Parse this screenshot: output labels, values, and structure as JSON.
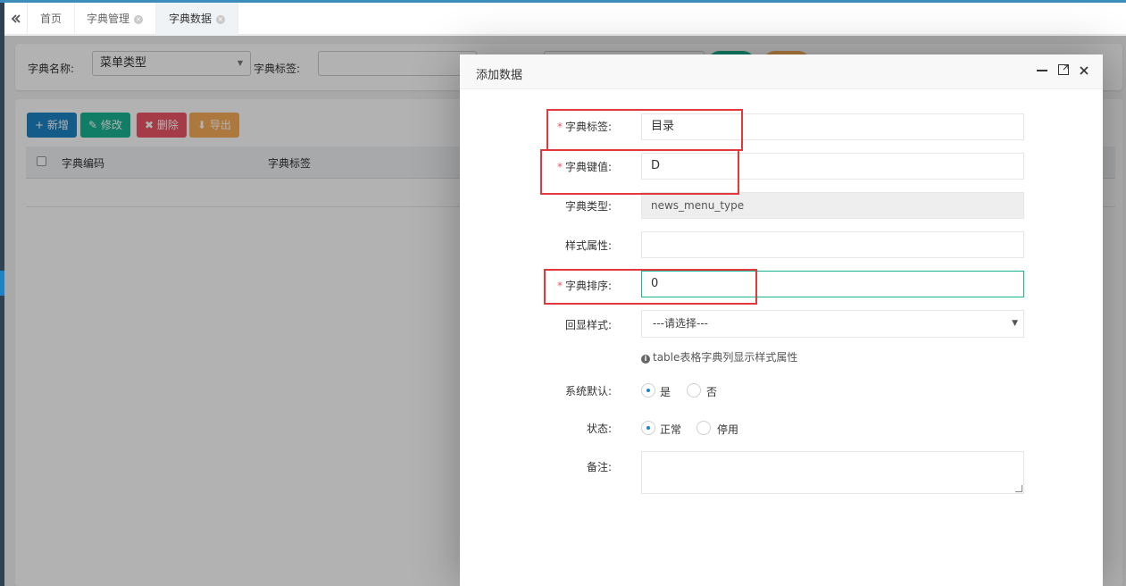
{
  "tabs": {
    "home": "首页",
    "items": [
      {
        "label": "字典管理",
        "active": false
      },
      {
        "label": "字典数据",
        "active": true
      }
    ]
  },
  "search": {
    "dict_name_label": "字典名称:",
    "dict_name_value": "菜单类型",
    "dict_label_label": "字典标签:"
  },
  "toolbar": {
    "add": "+ 新增",
    "edit": "修改",
    "delete": "删除",
    "export": "导出"
  },
  "table": {
    "columns": [
      "字典编码",
      "字典标签"
    ]
  },
  "dialog": {
    "title": "添加数据",
    "fields": {
      "label": {
        "label": "字典标签:",
        "value": "目录",
        "required": true
      },
      "value": {
        "label": "字典键值:",
        "value": "D",
        "required": true
      },
      "type": {
        "label": "字典类型:",
        "value": "news_menu_type"
      },
      "css": {
        "label": "样式属性:",
        "value": ""
      },
      "sort": {
        "label": "字典排序:",
        "value": "0",
        "required": true
      },
      "list_class": {
        "label": "回显样式:",
        "value": "---请选择---"
      },
      "list_class_hint": "table表格字典列显示样式属性",
      "is_default": {
        "label": "系统默认:",
        "options": [
          "是",
          "否"
        ],
        "selected": "是"
      },
      "status": {
        "label": "状态:",
        "options": [
          "正常",
          "停用"
        ],
        "selected": "正常"
      },
      "remark": {
        "label": "备注:",
        "value": ""
      }
    },
    "required_mark": "*"
  },
  "colors": {
    "primary": "#1c84c6",
    "success": "#1ab394",
    "danger": "#ed5565",
    "warning": "#f8ac59",
    "highlight_box": "#e4393c"
  }
}
